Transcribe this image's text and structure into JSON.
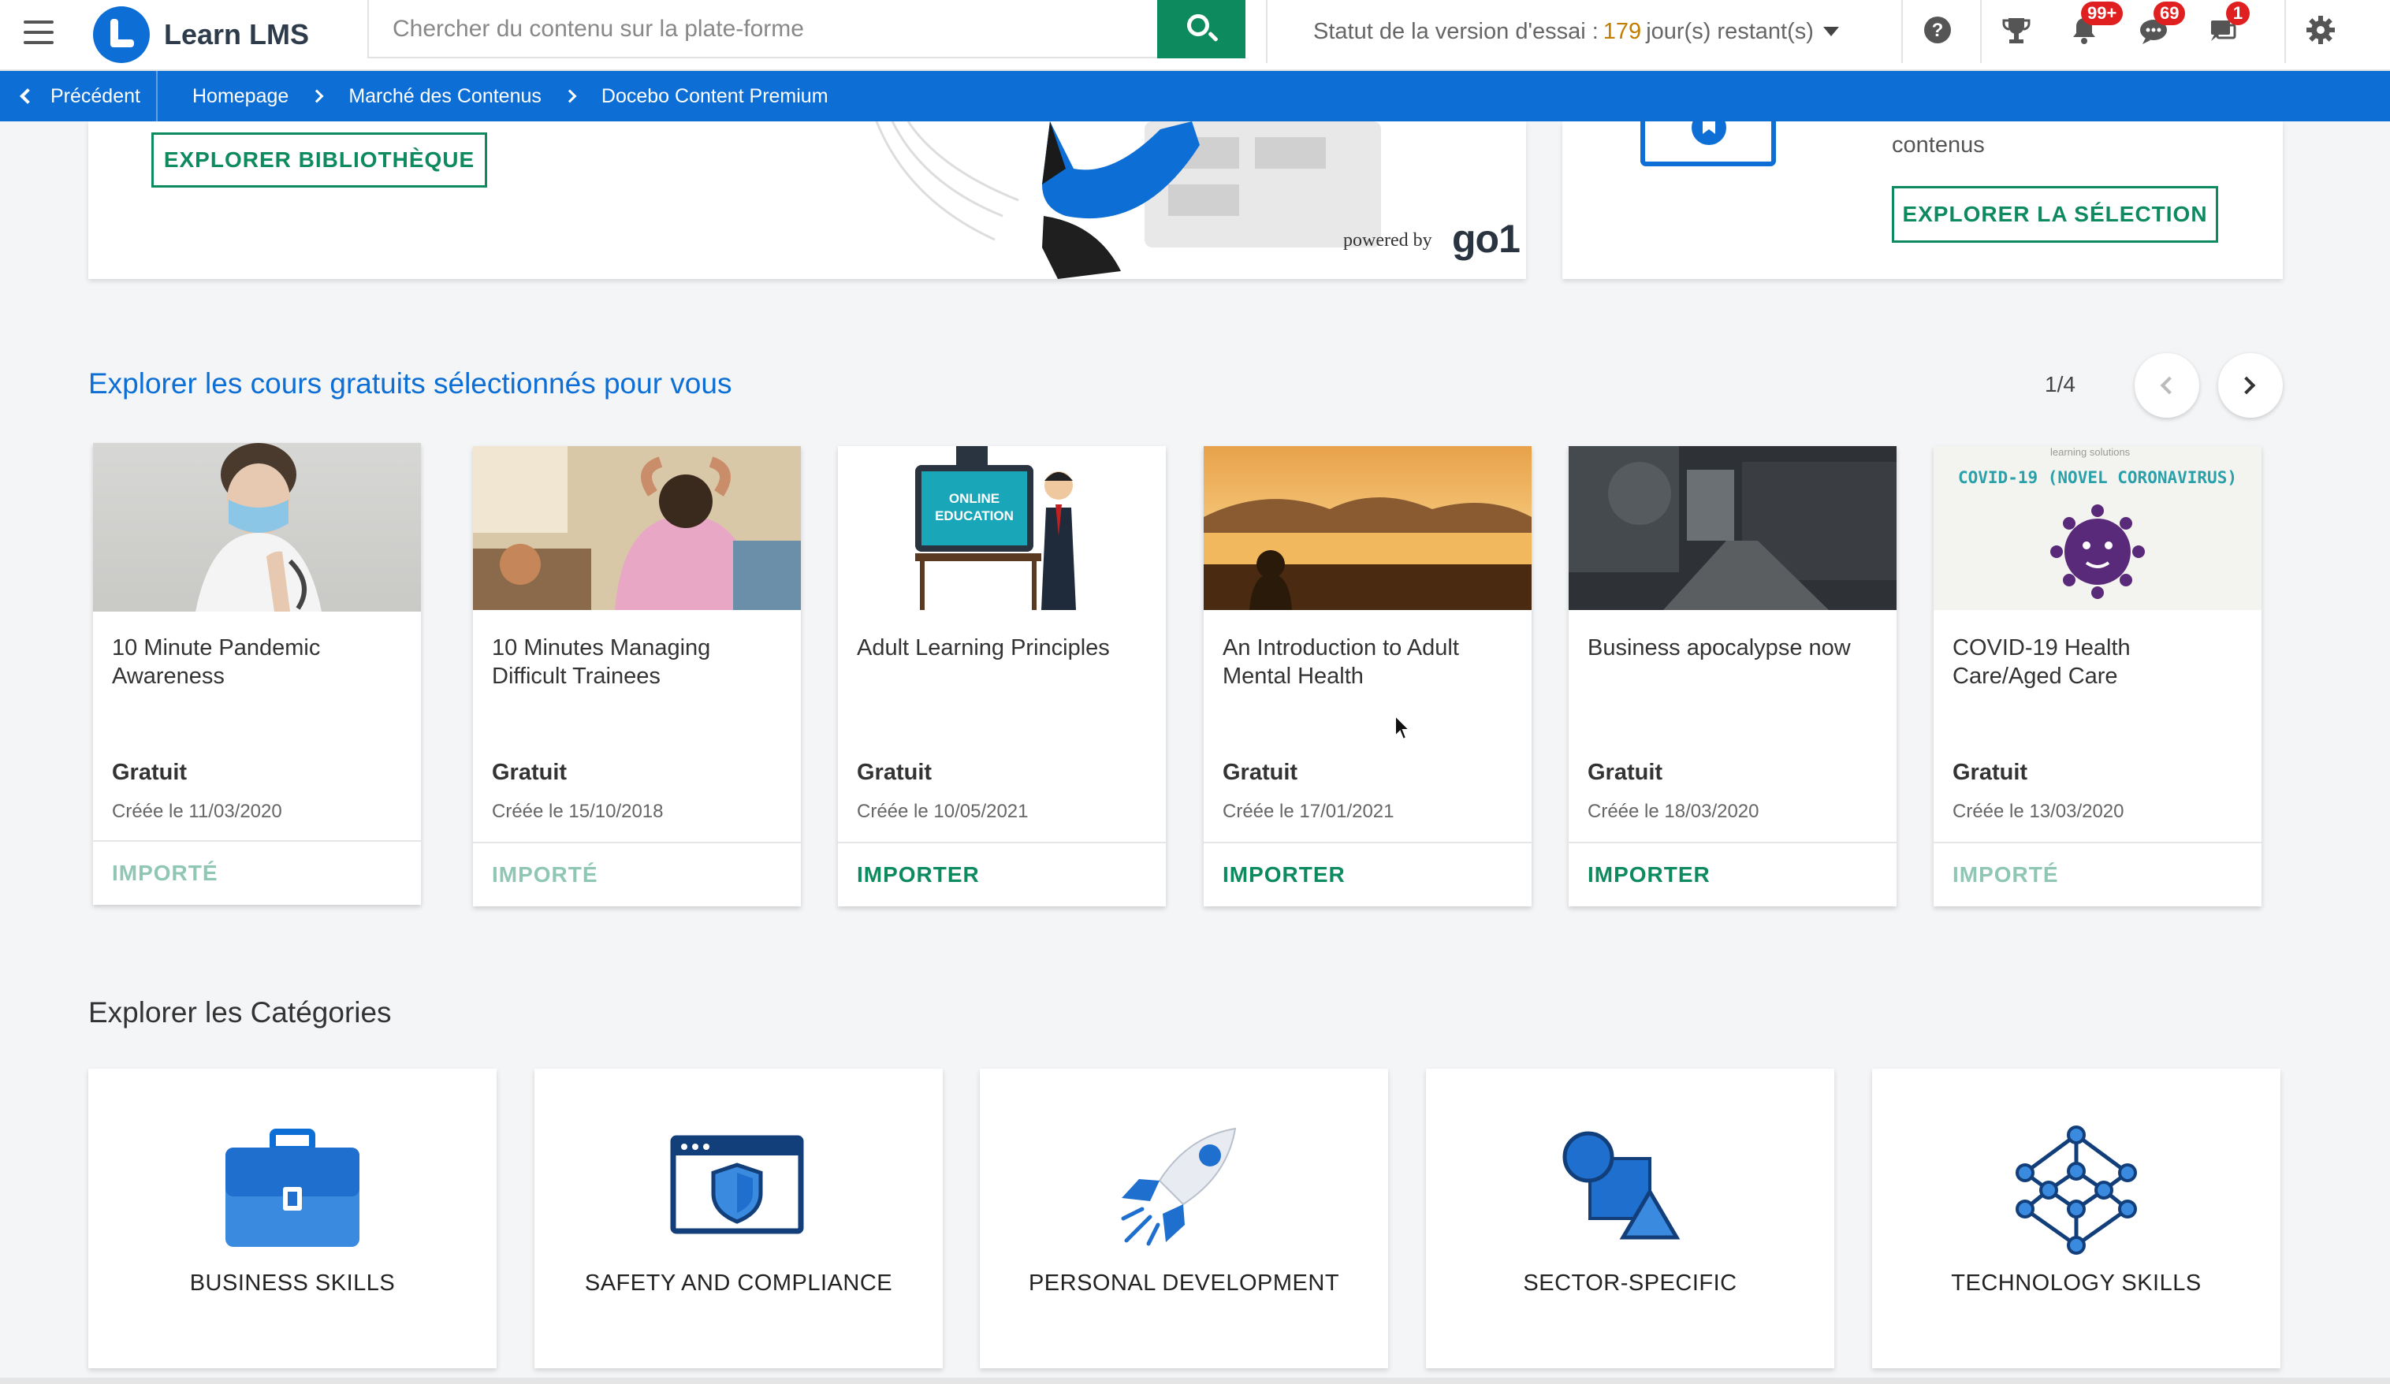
{
  "header": {
    "app_name": "Learn LMS",
    "search_placeholder": "Chercher du contenu sur la plate-forme",
    "trial_prefix": "Statut de la version d'essai :",
    "trial_days": "179",
    "trial_suffix": "jour(s) restant(s)",
    "badges": {
      "notifications": "99+",
      "messages": "69",
      "chat": "1"
    },
    "icons": [
      "menu-icon",
      "search-icon",
      "help-icon",
      "trophy-icon",
      "bell-icon",
      "message-icon",
      "chat-icon",
      "gear-icon"
    ]
  },
  "breadcrumb": {
    "back_label": "Précédent",
    "items": [
      "Homepage",
      "Marché des Contenus",
      "Docebo Content Premium"
    ]
  },
  "promo": {
    "explore_library": "EXPLORER BIBLIOTHÈQUE",
    "powered_by": "powered by",
    "go1": "go1",
    "selection_text": "contenus",
    "explore_selection": "EXPLORER LA SÉLECTION"
  },
  "courses": {
    "title": "Explorer les cours gratuits sélectionnés pour vous",
    "pager": "1/4",
    "items": [
      {
        "title": "10 Minute Pandemic Awareness",
        "price": "Gratuit",
        "date": "Créée le 11/03/2020",
        "action": "IMPORTÉ",
        "imported": true
      },
      {
        "title": "10 Minutes Managing Difficult Trainees",
        "price": "Gratuit",
        "date": "Créée le 15/10/2018",
        "action": "IMPORTÉ",
        "imported": true
      },
      {
        "title": "Adult Learning Principles",
        "price": "Gratuit",
        "date": "Créée le 10/05/2021",
        "action": "IMPORTER",
        "imported": false,
        "thumb_text": "ONLINE EDUCATION"
      },
      {
        "title": "An Introduction to Adult Mental Health",
        "price": "Gratuit",
        "date": "Créée le 17/01/2021",
        "action": "IMPORTER",
        "imported": false
      },
      {
        "title": "Business apocalypse now",
        "price": "Gratuit",
        "date": "Créée le 18/03/2020",
        "action": "IMPORTER",
        "imported": false
      },
      {
        "title": "COVID-19 Health Care/Aged Care",
        "price": "Gratuit",
        "date": "Créée le 13/03/2020",
        "action": "IMPORTÉ",
        "imported": true,
        "thumb_text": "COVID-19 (NOVEL CORONAVIRUS)",
        "thumb_small": "learning solutions"
      }
    ]
  },
  "categories": {
    "title": "Explorer les Catégories",
    "items": [
      {
        "label": "BUSINESS SKILLS",
        "icon": "briefcase-icon"
      },
      {
        "label": "SAFETY AND COMPLIANCE",
        "icon": "shield-window-icon"
      },
      {
        "label": "PERSONAL DEVELOPMENT",
        "icon": "rocket-icon"
      },
      {
        "label": "SECTOR-SPECIFIC",
        "icon": "shapes-icon"
      },
      {
        "label": "TECHNOLOGY SKILLS",
        "icon": "network-icon"
      }
    ]
  },
  "colors": {
    "brand_blue": "#0d6fd5",
    "action_green": "#0e8a5f",
    "imported_green": "#8fc7b4",
    "badge_red": "#e02020"
  }
}
